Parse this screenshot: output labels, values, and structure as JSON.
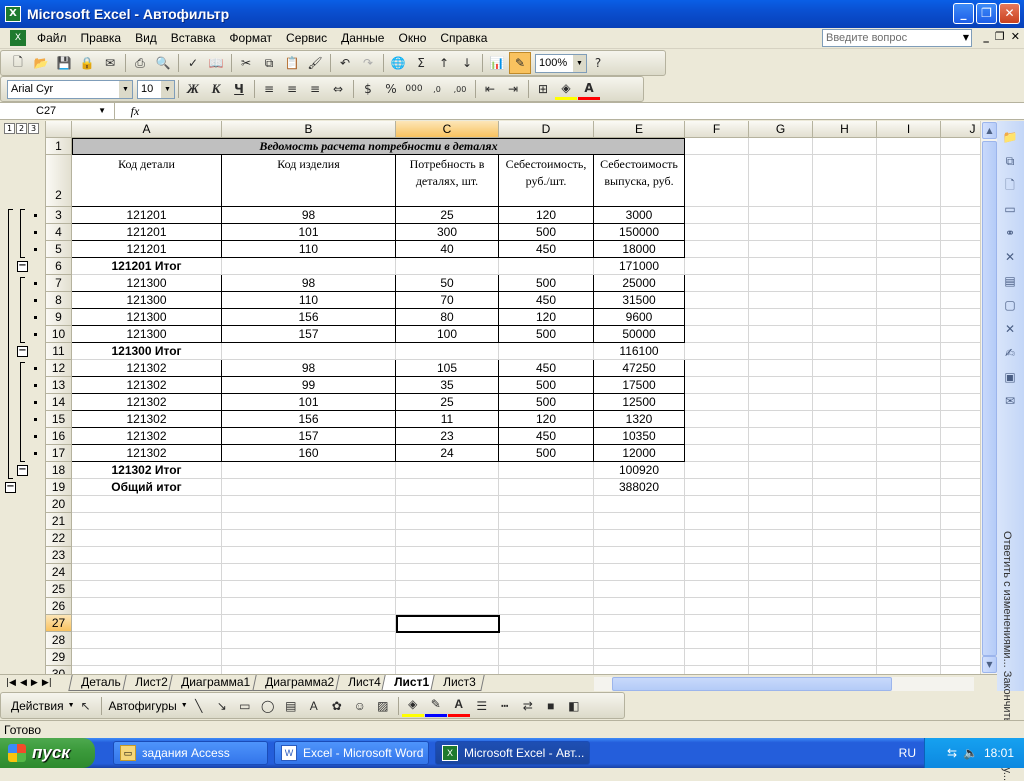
{
  "window": {
    "title": "Microsoft Excel - Автофильтр"
  },
  "menu": {
    "items": [
      "Файл",
      "Правка",
      "Вид",
      "Вставка",
      "Формат",
      "Сервис",
      "Данные",
      "Окно",
      "Справка"
    ],
    "ask_placeholder": "Введите вопрос"
  },
  "toolbar": {
    "zoom": "100%",
    "font": "Arial Cyr",
    "font_size": "10"
  },
  "formula": {
    "namebox": "C27",
    "fx": "fx",
    "content": ""
  },
  "sheet": {
    "columns": [
      "A",
      "B",
      "C",
      "D",
      "E",
      "F",
      "G",
      "H",
      "I",
      "J"
    ],
    "rows": [
      "1",
      "2",
      "3",
      "4",
      "5",
      "6",
      "7",
      "8",
      "9",
      "10",
      "11",
      "12",
      "13",
      "14",
      "15",
      "16",
      "17",
      "18",
      "19",
      "20",
      "21",
      "22",
      "23",
      "24",
      "25",
      "26",
      "27",
      "28",
      "29",
      "30"
    ],
    "title": "Ведомость расчета потребности в деталях",
    "headers": [
      "Код детали",
      "Код изделия",
      "Потребность в деталях, шт.",
      "Себестоимость, руб./шт.",
      "Себестоимость выпуска, руб."
    ],
    "data": [
      [
        "121201",
        "98",
        "25",
        "120",
        "3000"
      ],
      [
        "121201",
        "101",
        "300",
        "500",
        "150000"
      ],
      [
        "121201",
        "110",
        "40",
        "450",
        "18000"
      ],
      [
        "121201 Итог",
        "",
        "",
        "",
        "171000"
      ],
      [
        "121300",
        "98",
        "50",
        "500",
        "25000"
      ],
      [
        "121300",
        "110",
        "70",
        "450",
        "31500"
      ],
      [
        "121300",
        "156",
        "80",
        "120",
        "9600"
      ],
      [
        "121300",
        "157",
        "100",
        "500",
        "50000"
      ],
      [
        "121300 Итог",
        "",
        "",
        "",
        "116100"
      ],
      [
        "121302",
        "98",
        "105",
        "450",
        "47250"
      ],
      [
        "121302",
        "99",
        "35",
        "500",
        "17500"
      ],
      [
        "121302",
        "101",
        "25",
        "500",
        "12500"
      ],
      [
        "121302",
        "156",
        "11",
        "120",
        "1320"
      ],
      [
        "121302",
        "157",
        "23",
        "450",
        "10350"
      ],
      [
        "121302",
        "160",
        "24",
        "500",
        "12000"
      ],
      [
        "121302 Итог",
        "",
        "",
        "",
        "100920"
      ],
      [
        "Общий итог",
        "",
        "",
        "",
        "388020"
      ]
    ],
    "outline_levels": [
      "1",
      "2",
      "3"
    ]
  },
  "tabs": [
    "Деталь",
    "Лист2",
    "Диаграмма1",
    "Диаграмма2",
    "Лист4",
    "Лист1",
    "Лист3"
  ],
  "active_tab": "Лист1",
  "drawing": {
    "actions": "Действия",
    "autoshapes": "Автофигуры"
  },
  "status": {
    "text": "Готово"
  },
  "taskpane": {
    "text": "Ответить с изменениями... Закончить проверку..."
  },
  "taskbar": {
    "start": "пуск",
    "items": [
      "задания Access",
      "Excel - Microsoft Word",
      "Microsoft Excel - Авт..."
    ],
    "lang": "RU",
    "clock": "18:01"
  }
}
